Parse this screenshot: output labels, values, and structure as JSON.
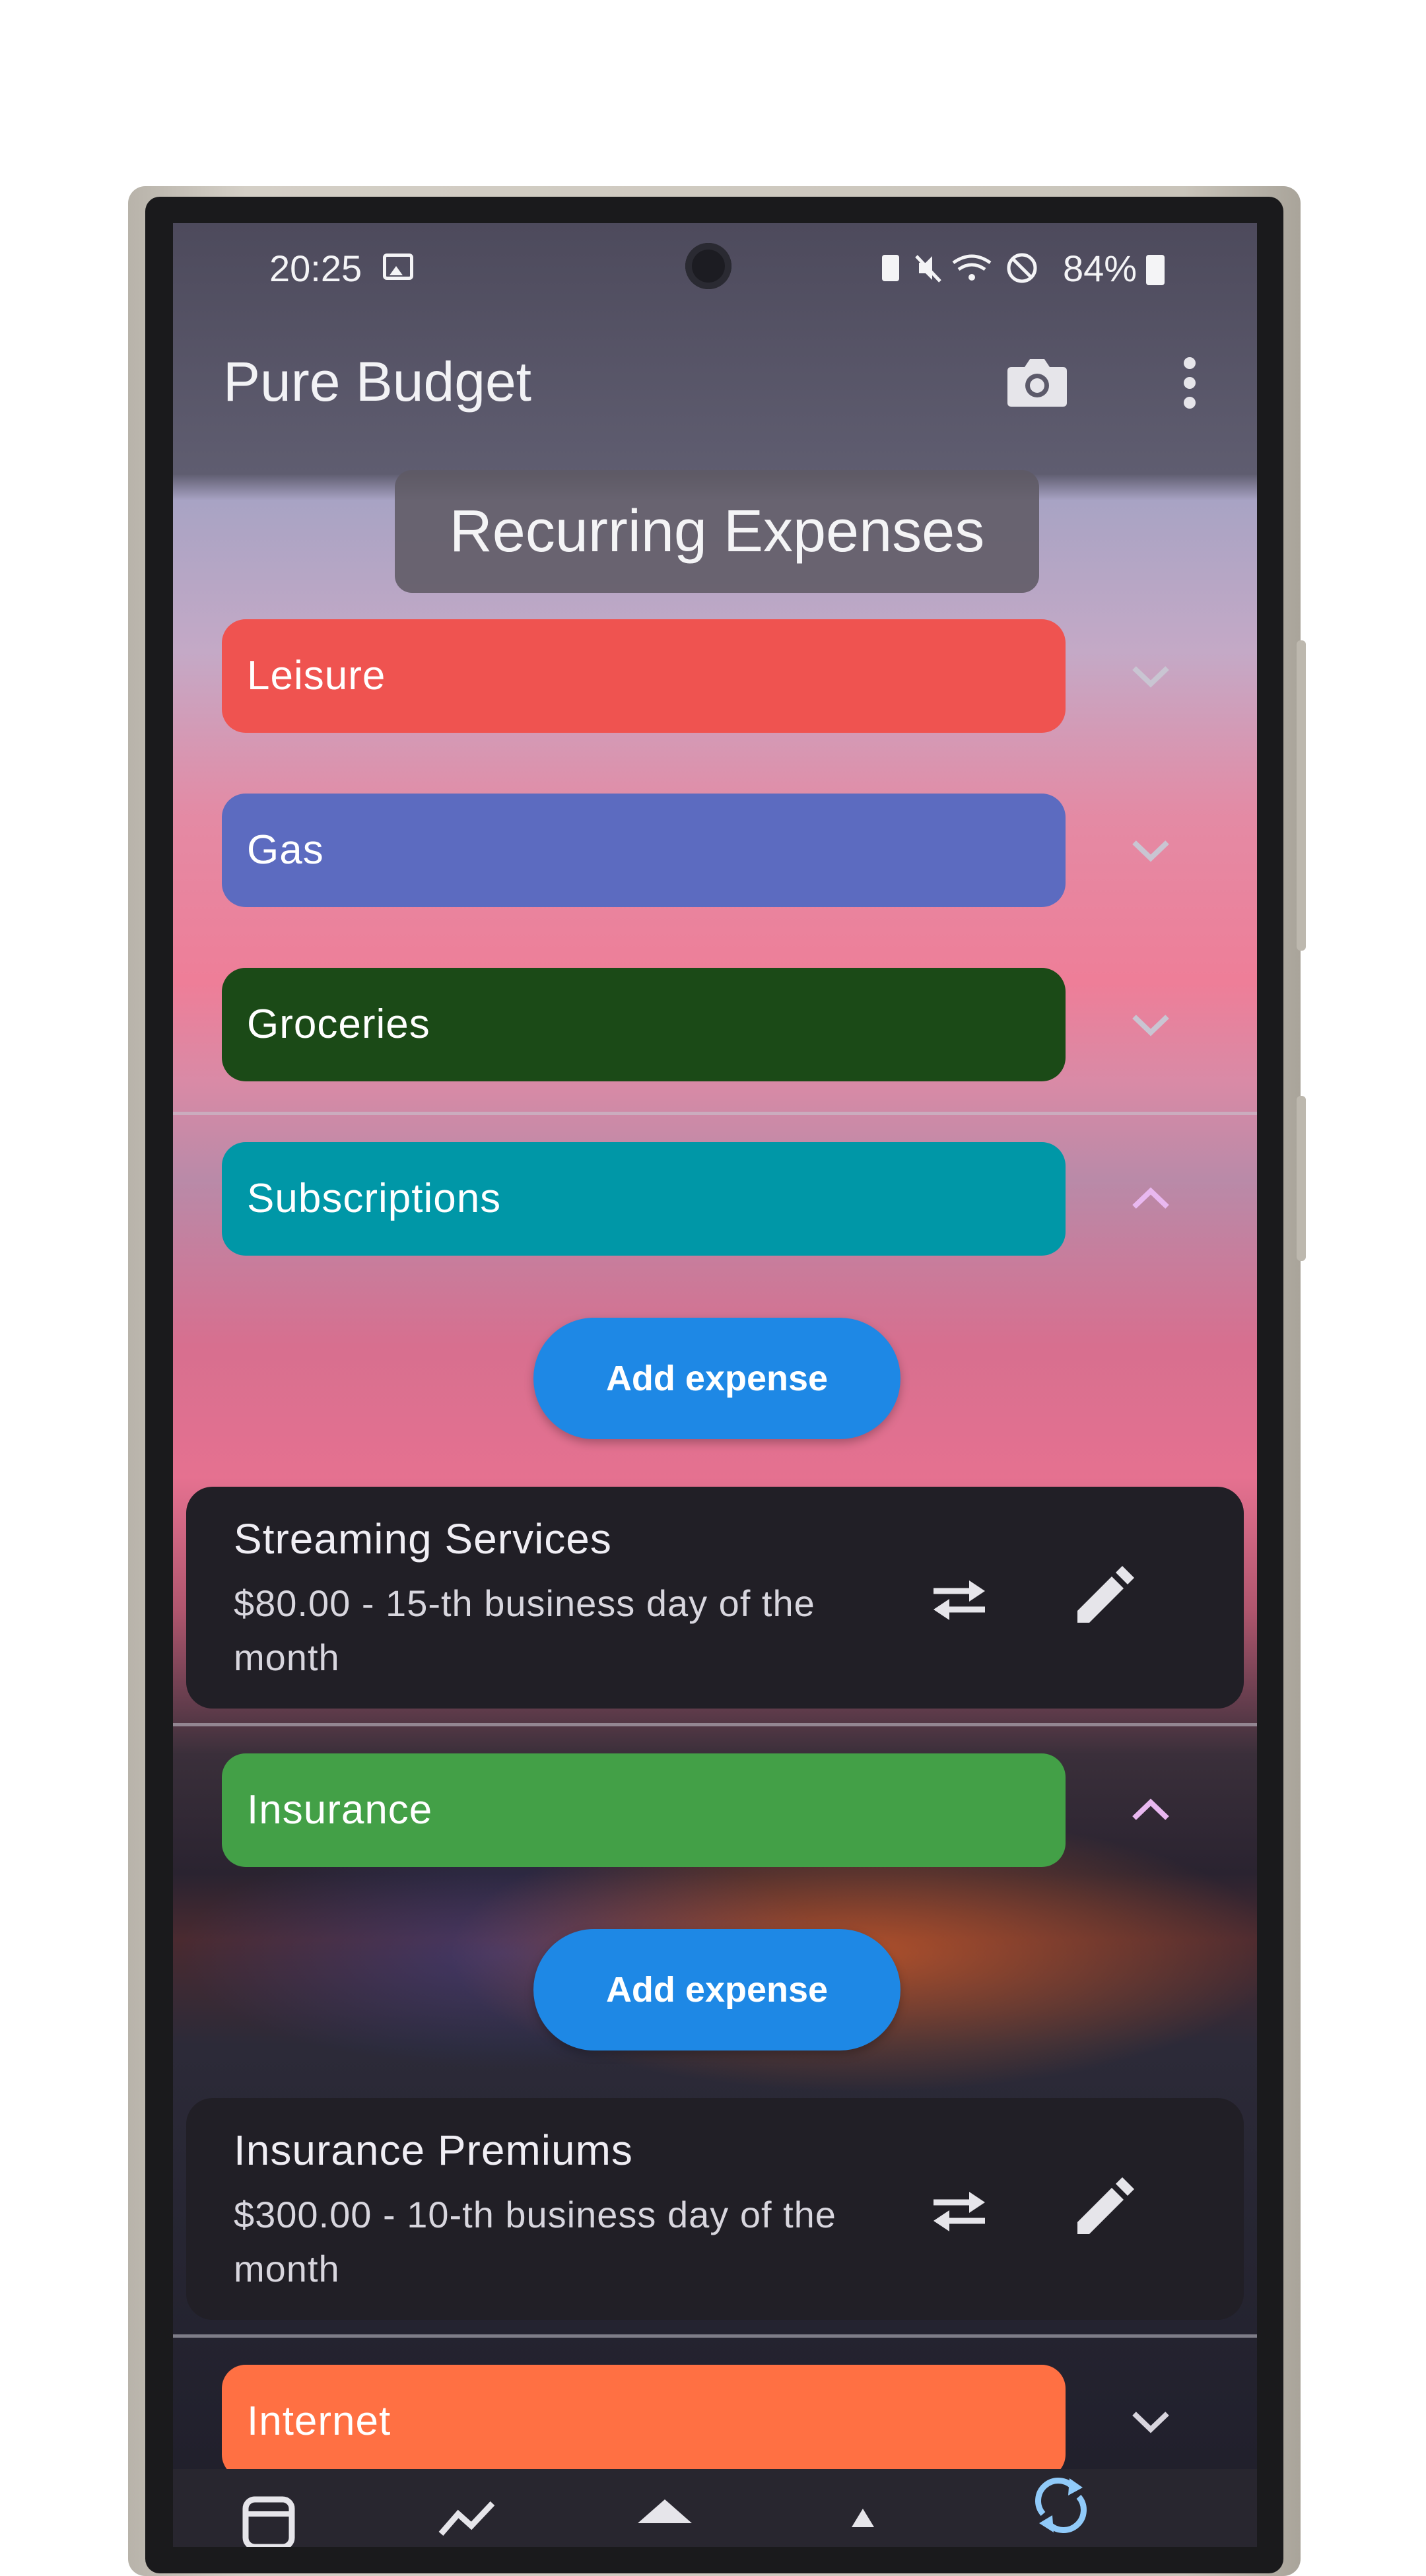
{
  "status_bar": {
    "time": "20:25",
    "battery": "84%",
    "icons": [
      "gallery-icon",
      "battery-saver-icon",
      "mute-icon",
      "wifi-icon",
      "do-not-disturb-icon"
    ]
  },
  "app_bar": {
    "title": "Pure Budget",
    "actions": [
      "camera-icon",
      "more-vert-icon"
    ]
  },
  "section": {
    "title": "Recurring Expenses"
  },
  "categories": [
    {
      "label": "Leisure",
      "color": "#ef5350",
      "expanded": false
    },
    {
      "label": "Gas",
      "color": "#5c6bc0",
      "expanded": false
    },
    {
      "label": "Groceries",
      "color": "#1b4a17",
      "expanded": false
    },
    {
      "label": "Subscriptions",
      "color": "#0097a7",
      "expanded": true,
      "add_label": "Add expense",
      "expense": {
        "name": "Streaming Services",
        "detail": "$80.00 - 15-th business day of the month"
      }
    },
    {
      "label": "Insurance",
      "color": "#43a047",
      "expanded": true,
      "add_label": "Add expense",
      "expense": {
        "name": "Insurance Premiums",
        "detail": "$300.00 - 10-th business day of the month"
      }
    },
    {
      "label": "Internet",
      "color": "#ff7043",
      "expanded": false
    }
  ],
  "colors": {
    "accent": "#1e88e5",
    "chevron_collapsed": "#c9c5d2",
    "chevron_expanded": "#e9b8f0",
    "card_bg": "#211f26"
  },
  "bottom_nav": {
    "icons": [
      "receipt-icon",
      "trend-icon",
      "home-icon",
      "up-icon",
      "sync-icon"
    ]
  }
}
